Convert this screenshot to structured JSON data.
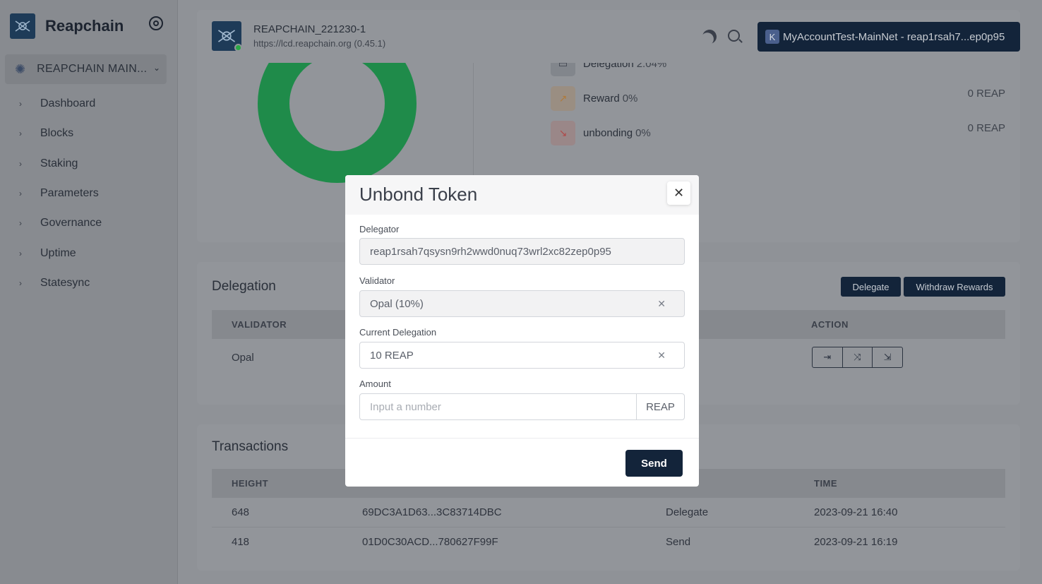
{
  "sidebar": {
    "brand": "Reapchain",
    "chain_selector": "REAPCHAIN MAIN...",
    "items": [
      {
        "label": "Dashboard"
      },
      {
        "label": "Blocks"
      },
      {
        "label": "Staking"
      },
      {
        "label": "Parameters"
      },
      {
        "label": "Governance"
      },
      {
        "label": "Uptime"
      },
      {
        "label": "Statesync"
      }
    ]
  },
  "header": {
    "chain_id": "REAPCHAIN_221230-1",
    "endpoint": "https://lcd.reapchain.org (0.45.1)",
    "account_initial": "K",
    "account_label": "MyAccountTest-MainNet - reap1rsah7...ep0p95"
  },
  "summary": {
    "rows": [
      {
        "label": "Delegation",
        "pct": "2.04%",
        "value": ""
      },
      {
        "label": "Reward",
        "pct": "0%",
        "value": "0 REAP"
      },
      {
        "label": "unbonding",
        "pct": "0%",
        "value": "0 REAP"
      }
    ]
  },
  "delegation": {
    "title": "Delegation",
    "delegate_button": "Delegate",
    "withdraw_button": "Withdraw Rewards",
    "col_validator": "VALIDATOR",
    "col_action": "ACTION",
    "rows": [
      {
        "validator": "Opal"
      }
    ]
  },
  "transactions": {
    "title": "Transactions",
    "col_height": "HEIGHT",
    "col_time": "TIME",
    "rows": [
      {
        "height": "648",
        "hash": "69DC3A1D63...3C83714DBC",
        "type": "Delegate",
        "time": "2023-09-21 16:40"
      },
      {
        "height": "418",
        "hash": "01D0C30ACD...780627F99F",
        "type": "Send",
        "time": "2023-09-21 16:19"
      }
    ]
  },
  "modal": {
    "title": "Unbond Token",
    "delegator_label": "Delegator",
    "delegator_value": "reap1rsah7qsysn9rh2wwd0nuq73wrl2xc82zep0p95",
    "validator_label": "Validator",
    "validator_value": "Opal (10%)",
    "current_label": "Current Delegation",
    "current_value": "10 REAP",
    "amount_label": "Amount",
    "amount_placeholder": "Input a number",
    "amount_unit": "REAP",
    "send_button": "Send"
  },
  "colors": {
    "accent_dark": "#13243a",
    "donut_green": "#1f8b4a",
    "online_dot": "#28a745"
  }
}
